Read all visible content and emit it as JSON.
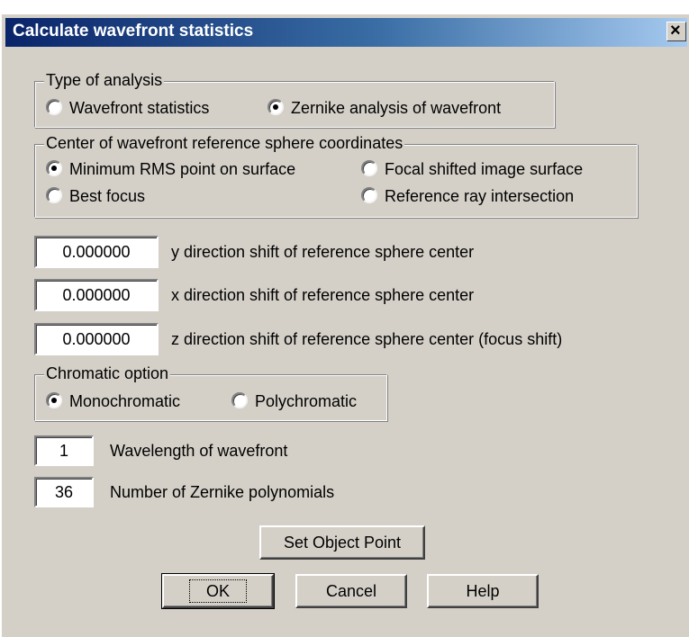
{
  "window": {
    "title": "Calculate wavefront statistics",
    "close_label": "×"
  },
  "analysis_type": {
    "label": "Type of analysis",
    "options": [
      "Wavefront statistics",
      "Zernike analysis of wavefront"
    ],
    "selected": "Zernike analysis of wavefront"
  },
  "reference_center": {
    "label": "Center of wavefront reference sphere coordinates",
    "options": [
      "Minimum RMS point on surface",
      "Focal shifted image surface",
      "Best focus",
      "Reference ray intersection"
    ],
    "selected": "Minimum RMS point on surface"
  },
  "shifts": [
    {
      "value": "0.000000",
      "label": "y direction shift of reference sphere center"
    },
    {
      "value": "0.000000",
      "label": "x direction shift of reference sphere center"
    },
    {
      "value": "0.000000",
      "label": "z direction shift of reference sphere center (focus shift)"
    }
  ],
  "chromatic": {
    "label": "Chromatic option",
    "options": [
      "Monochromatic",
      "Polychromatic"
    ],
    "selected": "Monochromatic"
  },
  "wavelength": {
    "value": "1",
    "label": "Wavelength of wavefront"
  },
  "zernike": {
    "value": "36",
    "label": "Number of Zernike polynomials"
  },
  "buttons": {
    "set_object_point": "Set Object Point",
    "ok": "OK",
    "cancel": "Cancel",
    "help": "Help"
  }
}
